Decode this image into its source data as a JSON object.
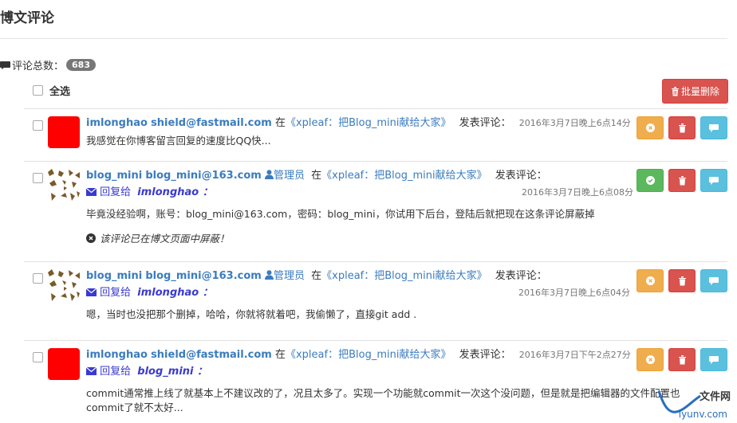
{
  "page": {
    "title": "博文评论"
  },
  "summary": {
    "label": "评论总数：",
    "count": "683"
  },
  "toolbar": {
    "select_all": "全选",
    "batch_delete": "批量删除"
  },
  "comments": [
    {
      "avatar_style": "red",
      "username": "imlonghao",
      "email": "shield@fastmail.com",
      "is_admin": false,
      "admin_label": "",
      "in_word": "在",
      "post_link": "《xpleaf：把Blog_mini献给大家》",
      "said": "发表评论：",
      "time": "2016年3月7日晚上6点14分",
      "reply_prefix": "",
      "reply_to": "",
      "text": "我感觉在你博客留言回复的速度比QQ快...",
      "hidden_note": "",
      "status_button": "unblock"
    },
    {
      "avatar_style": "pattern",
      "username": "blog_mini",
      "email": "blog_mini@163.com",
      "is_admin": true,
      "admin_label": "管理员",
      "in_word": "在",
      "post_link": "《xpleaf：把Blog_mini献给大家》",
      "said": "发表评论：",
      "time": "2016年3月7日晚上6点08分",
      "reply_prefix": "回复给",
      "reply_to": "imlonghao ：",
      "text": "毕竟没经验啊，账号：blog_mini@163.com，密码：blog_mini，你试用下后台，登陆后就把现在这条评论屏蔽掉",
      "hidden_note": "该评论已在博文页面中屏蔽！",
      "status_button": "ok"
    },
    {
      "avatar_style": "pattern",
      "username": "blog_mini",
      "email": "blog_mini@163.com",
      "is_admin": true,
      "admin_label": "管理员",
      "in_word": "在",
      "post_link": "《xpleaf：把Blog_mini献给大家》",
      "said": "发表评论：",
      "time": "2016年3月7日晚上6点04分",
      "reply_prefix": "回复给",
      "reply_to": "imlonghao ：",
      "text": "嗯，当时也没把那个删掉，哈哈，你就将就着吧，我偷懒了，直接git add .",
      "hidden_note": "",
      "status_button": "unblock"
    },
    {
      "avatar_style": "red",
      "username": "imlonghao",
      "email": "shield@fastmail.com",
      "is_admin": false,
      "admin_label": "",
      "in_word": "在",
      "post_link": "《xpleaf：把Blog_mini献给大家》",
      "said": "发表评论：",
      "time": "2016年3月7日下午2点27分",
      "reply_prefix": "回复给",
      "reply_to": "blog_mini ：",
      "text": "commit通常推上线了就基本上不建议改的了，况且太多了。实现一个功能就commit一次这个没问题，但是就是把编辑器的文件配置也commit了就不太好...",
      "hidden_note": "",
      "status_button": "unblock"
    }
  ],
  "watermark": {
    "top": "文件网",
    "bottom": "iyunv.com"
  },
  "colors": {
    "primary": "#3a7cbf",
    "danger": "#d9534f",
    "warning": "#f0ad4e",
    "success": "#5cb85c",
    "info": "#5bc0de"
  }
}
